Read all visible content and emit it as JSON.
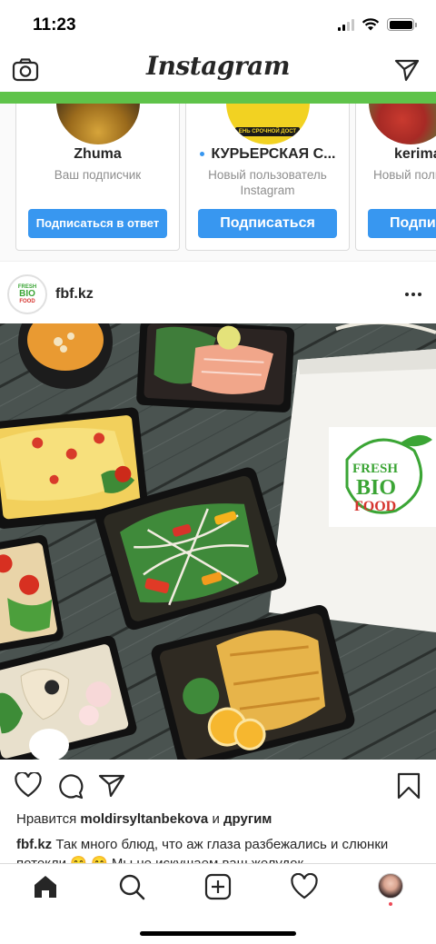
{
  "status_bar": {
    "time": "11:23"
  },
  "header": {
    "logo": "Instagram",
    "camera_icon": "camera-icon",
    "direct_icon": "paper-plane-icon"
  },
  "suggestions": [
    {
      "name": "Zhuma",
      "subtitle": "Ваш подписчик",
      "button": "Подписаться в ответ",
      "new_dot": false
    },
    {
      "name": "КУРЬЕРСКАЯ С...",
      "subtitle": "Новый пользователь Instagram",
      "button": "Подписаться",
      "new_dot": true,
      "avatar_text": "ЕНЬ СРОЧНОЙ ДОСТ"
    },
    {
      "name": "kerima",
      "subtitle": "Новый польз Insta",
      "button": "Подпи",
      "new_dot": false
    }
  ],
  "post": {
    "username": "fbf.kz",
    "avatar_logo_lines": [
      "FRESH",
      "BIO",
      "FOOD"
    ],
    "bag_logo_lines": [
      "FRESH",
      "BIO",
      "FOOD"
    ],
    "likes_prefix": "Нравится",
    "likes_user": "moldirsyltanbekova",
    "likes_joiner": "и",
    "likes_others": "другим",
    "caption_user": "fbf.kz",
    "caption_text": "Так много блюд, что аж глаза разбежались и слюнки потекли 😋 😊 Мы не искушаем ваш желудок"
  },
  "tabs": [
    "home-icon",
    "search-icon",
    "new-post-icon",
    "activity-heart-icon",
    "profile-avatar"
  ],
  "colors": {
    "accent_blue": "#3897f0",
    "progress_green": "#5fc34a",
    "logo_green": "#3ba535",
    "logo_red": "#d6342e",
    "notification_red": "#ed4956"
  }
}
